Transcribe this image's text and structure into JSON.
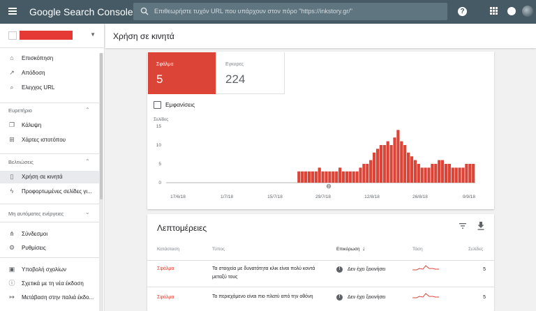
{
  "app": {
    "title": "Google Search Console",
    "search_placeholder": "Επιθεωρήστε τυχόν URL που υπάρχουν στον πόρο \"https://inkstory.gr/\""
  },
  "sidebar": {
    "items_top": [
      {
        "label": "Επισκόπηση",
        "icon": "home-icon",
        "glyph": "⌂"
      },
      {
        "label": "Απόδοση",
        "icon": "trending-icon",
        "glyph": "↗"
      },
      {
        "label": "Ελεγχος URL",
        "icon": "search-icon",
        "glyph": "⌕"
      }
    ],
    "section_index": "Ευρετήριο",
    "items_index": [
      {
        "label": "Κάλυψη",
        "icon": "coverage-icon",
        "glyph": "❐"
      },
      {
        "label": "Χάρτες ιστοτόπου",
        "icon": "sitemap-icon",
        "glyph": "⊞"
      }
    ],
    "section_enh": "Βελτιώσεις",
    "items_enh": [
      {
        "label": "Χρήση σε κινητά",
        "icon": "mobile-icon",
        "glyph": "▯"
      },
      {
        "label": "Προφορτωμένες σελίδες γι...",
        "icon": "bolt-icon",
        "glyph": "ϟ"
      }
    ],
    "section_auto": "Μη αυτόματες ενέργειες",
    "items_bottom": [
      {
        "label": "Σύνδεσμοι",
        "icon": "links-icon",
        "glyph": "⋔"
      },
      {
        "label": "Ρυθμίσεις",
        "icon": "settings-icon",
        "glyph": "⚙"
      }
    ],
    "items_footer": [
      {
        "label": "Υποβολή σχολίων",
        "icon": "feedback-icon",
        "glyph": "▣"
      },
      {
        "label": "Σχετικά με τη νέα έκδοση",
        "icon": "info-icon",
        "glyph": "ⓘ"
      },
      {
        "label": "Μετάβαση στην παλιά έκδο...",
        "icon": "exit-icon",
        "glyph": "↦"
      }
    ]
  },
  "header": {
    "title": "Χρήση σε κινητά"
  },
  "tiles": {
    "error_label": "Σφάλμα",
    "error_value": "5",
    "valid_label": "Εγκυρες",
    "valid_value": "224"
  },
  "impressions_label": "Εμφανίσεις",
  "chart_data": {
    "type": "bar",
    "ylabel": "Σελίδες",
    "ylim": [
      0,
      15
    ],
    "yticks": [
      "15",
      "10",
      "5",
      "0"
    ],
    "xticks": [
      "17/6/18",
      "1/7/18",
      "15/7/18",
      "29/7/18",
      "12/8/18",
      "26/8/18",
      "9/9/18"
    ],
    "marker_label": "2",
    "values": [
      3,
      3,
      3,
      3,
      3,
      3,
      4,
      3,
      3,
      3,
      3,
      3,
      4,
      3,
      3,
      3,
      3,
      3,
      4,
      5,
      5,
      6,
      8,
      9,
      10,
      10,
      11,
      10,
      12,
      14,
      11,
      10,
      8,
      7,
      6,
      5,
      4,
      4,
      4,
      5,
      5,
      6,
      6,
      5,
      5,
      4,
      4,
      4,
      4,
      5,
      5,
      5
    ],
    "colors": {
      "bar": "#db4437",
      "baseline": "#9e9e9e"
    }
  },
  "details": {
    "title": "Λεπτομέρειες",
    "columns": [
      "Κατάσταση",
      "Τύπος",
      "Επικύρωση",
      "Τάση",
      "Σελίδες"
    ],
    "rows": [
      {
        "status": "Σφάλμα",
        "type": "Τα στοιχεία με δυνατότητα κλικ είναι πολύ κοντά μεταξύ τους",
        "validation": "Δεν έχει ξεκινήσει",
        "pages": "5"
      },
      {
        "status": "Σφάλμα",
        "type": "Το περιεχόμενο είναι πιο πλατύ από την οθόνη",
        "validation": "Δεν έχει ξεκινήσει",
        "pages": "5"
      }
    ]
  }
}
